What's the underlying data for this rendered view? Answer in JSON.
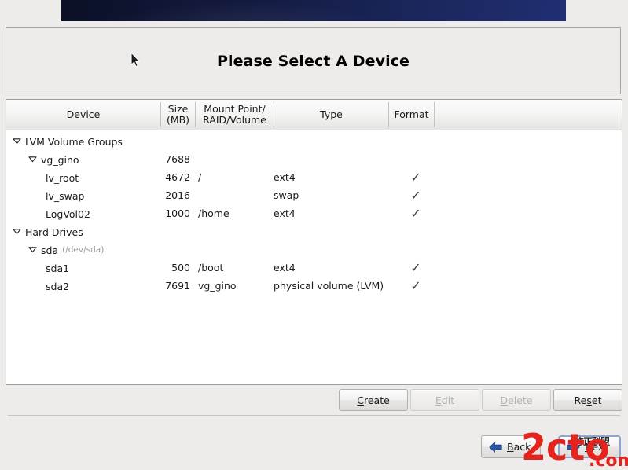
{
  "window": {
    "title": "Please Select A Device",
    "banner_color_start": "#0b1026",
    "banner_color_end": "#202f73"
  },
  "table": {
    "columns": [
      {
        "key": "device",
        "label": "Device"
      },
      {
        "key": "size",
        "label": "Size\n(MB)",
        "label_line1": "Size",
        "label_line2": "(MB)"
      },
      {
        "key": "mount",
        "label": "Mount Point/\nRAID/Volume",
        "label_line1": "Mount Point/",
        "label_line2": "RAID/Volume"
      },
      {
        "key": "type",
        "label": "Type"
      },
      {
        "key": "format",
        "label": "Format"
      }
    ],
    "rows": [
      {
        "indent": 0,
        "twisty": "expanded",
        "device": "LVM Volume Groups",
        "devpath": "",
        "size": "",
        "mount": "",
        "type": "",
        "format": ""
      },
      {
        "indent": 1,
        "twisty": "expanded",
        "device": "vg_gino",
        "devpath": "",
        "size": "7688",
        "mount": "",
        "type": "",
        "format": ""
      },
      {
        "indent": 2,
        "twisty": "none",
        "device": "lv_root",
        "devpath": "",
        "size": "4672",
        "mount": "/",
        "type": "ext4",
        "format": "check"
      },
      {
        "indent": 2,
        "twisty": "none",
        "device": "lv_swap",
        "devpath": "",
        "size": "2016",
        "mount": "",
        "type": "swap",
        "format": "check"
      },
      {
        "indent": 2,
        "twisty": "none",
        "device": "LogVol02",
        "devpath": "",
        "size": "1000",
        "mount": "/home",
        "type": "ext4",
        "format": "check"
      },
      {
        "indent": 0,
        "twisty": "expanded",
        "device": "Hard Drives",
        "devpath": "",
        "size": "",
        "mount": "",
        "type": "",
        "format": ""
      },
      {
        "indent": 1,
        "twisty": "expanded",
        "device": "sda",
        "devpath": "(/dev/sda)",
        "size": "",
        "mount": "",
        "type": "",
        "format": ""
      },
      {
        "indent": 2,
        "twisty": "none",
        "device": "sda1",
        "devpath": "",
        "size": "500",
        "mount": "/boot",
        "type": "ext4",
        "format": "check"
      },
      {
        "indent": 2,
        "twisty": "none",
        "device": "sda2",
        "devpath": "",
        "size": "7691",
        "mount": "vg_gino",
        "type": "physical volume (LVM)",
        "format": "check"
      }
    ],
    "check_glyph": "✓",
    "check_color": "#333a52"
  },
  "actions": {
    "create": {
      "label": "Create",
      "mnemonic_index": 0,
      "enabled": true
    },
    "edit": {
      "label": "Edit",
      "mnemonic_index": 0,
      "enabled": false
    },
    "delete": {
      "label": "Delete",
      "mnemonic_index": 0,
      "enabled": false
    },
    "reset": {
      "label": "Reset",
      "mnemonic_index": 2,
      "enabled": true
    }
  },
  "navigation": {
    "back": {
      "label": "Back",
      "mnemonic_index": 0,
      "icon": "arrow-left-icon"
    },
    "next": {
      "label": "Next",
      "mnemonic_index": 0,
      "icon": "arrow-right-icon"
    }
  },
  "watermark": {
    "text": "2cto",
    "suffix": ".com",
    "color": "#e5231c",
    "cjk_text": "修正联盟"
  }
}
